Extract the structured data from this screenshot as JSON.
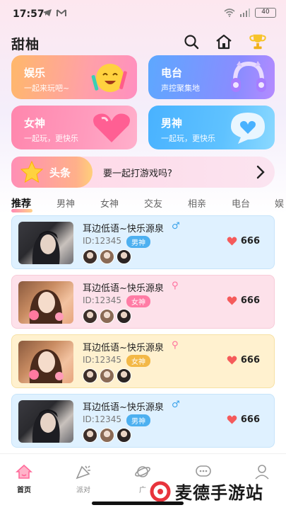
{
  "status_bar": {
    "time": "17:57",
    "battery": "40"
  },
  "header": {
    "title": "甜柚"
  },
  "categories": [
    {
      "title": "娱乐",
      "subtitle": "一起来玩吧~",
      "color_start": "#ffbd63",
      "color_end": "#ff8fb8"
    },
    {
      "title": "电台",
      "subtitle": "声控聚集地",
      "color_start": "#6aa3ff",
      "color_end": "#9f8cff"
    },
    {
      "title": "女神",
      "subtitle": "一起玩，更快乐",
      "color_start": "#ff8fb5",
      "color_end": "#ff9ac3"
    },
    {
      "title": "男神",
      "subtitle": "一起玩，更快乐",
      "color_start": "#4fb3ff",
      "color_end": "#6fd0ff"
    }
  ],
  "news": {
    "tag": "头条",
    "text": "要一起打游戏吗?"
  },
  "tabs": [
    "推荐",
    "男神",
    "女神",
    "交友",
    "相亲",
    "电台",
    "娱"
  ],
  "list": [
    {
      "name": "耳边低语~快乐源泉",
      "gender": "♂",
      "id": "ID:12345",
      "badge": "男神",
      "heat": "666"
    },
    {
      "name": "耳边低语~快乐源泉",
      "gender": "⚲",
      "id": "ID:12345",
      "badge": "女神",
      "heat": "666"
    },
    {
      "name": "耳边低语~快乐源泉",
      "gender": "⚲",
      "id": "ID:12345",
      "badge": "女神",
      "heat": "666"
    },
    {
      "name": "耳边低语~快乐源泉",
      "gender": "♂",
      "id": "ID:12345",
      "badge": "男神",
      "heat": "666"
    }
  ],
  "bottom_nav": [
    {
      "label": "首页",
      "icon": "home-icon"
    },
    {
      "label": "派对",
      "icon": "party-icon"
    },
    {
      "label": "广",
      "icon": "planet-icon"
    },
    {
      "label": "",
      "icon": "chat-icon"
    },
    {
      "label": "",
      "icon": "profile-icon"
    }
  ],
  "watermark": {
    "text": "麦德手游站"
  }
}
